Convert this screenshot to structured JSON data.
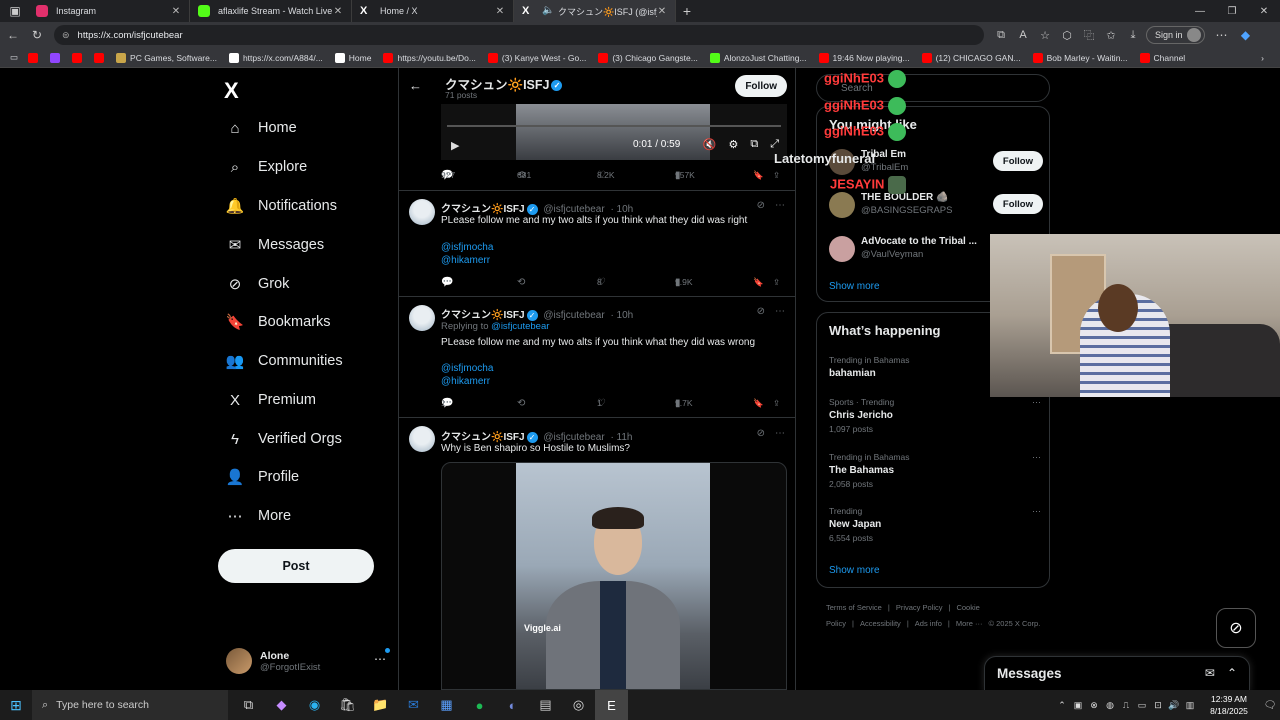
{
  "browser": {
    "tabs": [
      {
        "title": "Instagram",
        "color": "#e1306c"
      },
      {
        "title": "aflaxlife Stream - Watch Live on K",
        "color": "#53fc18"
      },
      {
        "title": "Home / X",
        "color": "#ffffff"
      },
      {
        "title": "クマシュン🔆ISFJ (@isfjcutebe",
        "color": "#ffffff"
      }
    ],
    "new_tab": "+",
    "url": "https://x.com/isfjcutebear",
    "sign_in": "Sign in",
    "bookmarks": [
      {
        "label": "",
        "color": "#ff0000"
      },
      {
        "label": "",
        "color": "#9146ff"
      },
      {
        "label": "",
        "color": "#ff0000"
      },
      {
        "label": "",
        "color": "#ff0000"
      },
      {
        "label": "PC Games, Software...",
        "color": "#c9a64a"
      },
      {
        "label": "https://x.com/A884/...",
        "color": "#ffffff"
      },
      {
        "label": "Home",
        "color": "#ffffff"
      },
      {
        "label": "https://youtu.be/Do...",
        "color": "#ff0000"
      },
      {
        "label": "(3) Kanye West - Go...",
        "color": "#ff0000"
      },
      {
        "label": "(3) Chicago Gangste...",
        "color": "#ff0000"
      },
      {
        "label": "AlonzoJust Chatting...",
        "color": "#53fc18"
      },
      {
        "label": "19:46 Now playing...",
        "color": "#ff0000"
      },
      {
        "label": "(12) CHICAGO GAN...",
        "color": "#ff0000"
      },
      {
        "label": "Bob Marley - Waitin...",
        "color": "#ff0000"
      },
      {
        "label": "Channel",
        "color": "#ff0000"
      }
    ]
  },
  "nav": {
    "logo": "X",
    "items": [
      {
        "label": "Home",
        "icon": "⌂"
      },
      {
        "label": "Explore",
        "icon": "⌕"
      },
      {
        "label": "Notifications",
        "icon": "🔔"
      },
      {
        "label": "Messages",
        "icon": "✉"
      },
      {
        "label": "Grok",
        "icon": "⊘"
      },
      {
        "label": "Bookmarks",
        "icon": "🔖"
      },
      {
        "label": "Communities",
        "icon": "👥"
      },
      {
        "label": "Premium",
        "icon": "X"
      },
      {
        "label": "Verified Orgs",
        "icon": "ϟ"
      },
      {
        "label": "Profile",
        "icon": "👤"
      },
      {
        "label": "More",
        "icon": "⋯"
      }
    ],
    "post": "Post",
    "user": {
      "name": "Alone",
      "handle": "@ForgotIExist"
    }
  },
  "profile": {
    "name": "クマシュン🔆ISFJ",
    "posts": "71 posts",
    "follow": "Follow"
  },
  "video1": {
    "time": "0:01 / 0:59"
  },
  "tweets": [
    {
      "stats": {
        "replies": "927",
        "reposts": "681",
        "likes": "8.2K",
        "views": "957K"
      }
    },
    {
      "name": "クマシュン🔆ISFJ",
      "handle": "@isfjcutebear",
      "time": "· 10h",
      "text": "PLease follow me and my two alts if you think what they did was right",
      "links": [
        "@isfjmocha",
        "@hikamerr"
      ],
      "stats": {
        "replies": "",
        "reposts": "",
        "likes": "8",
        "views": "9.9K"
      }
    },
    {
      "name": "クマシュン🔆ISFJ",
      "handle": "@isfjcutebear",
      "time": "· 10h",
      "reply_prefix": "Replying to",
      "reply_to": "@isfjcutebear",
      "text": "PLease follow me and my two alts if you think what they did was wrong",
      "links": [
        "@isfjmocha",
        "@hikamerr"
      ],
      "stats": {
        "replies": "1",
        "reposts": "",
        "likes": "1",
        "views": "9.7K"
      }
    },
    {
      "name": "クマシュン🔆ISFJ",
      "handle": "@isfjcutebear",
      "time": "· 11h",
      "text": "Why is Ben shapiro so Hostile to Muslims?",
      "watermark": "Viggle.ai"
    }
  ],
  "sidebar": {
    "search": "Search",
    "who_to_follow": "You might like",
    "suggestions": [
      {
        "name": "Tribal Em",
        "handle": "@TribalEm",
        "follow": "Follow"
      },
      {
        "name": "THE BOULDER 🪨",
        "handle": "@BASINGSEGRAPS",
        "follow": "Follow"
      },
      {
        "name": "AdVocate to the Tribal ...",
        "handle": "@VaulVeyman",
        "follow": ""
      }
    ],
    "show_more": "Show more",
    "happening_title": "What’s happening",
    "trends": [
      {
        "context": "Trending in Bahamas",
        "topic": "bahamian",
        "posts": ""
      },
      {
        "context": "Sports · Trending",
        "topic": "Chris Jericho",
        "posts": "1,097 posts"
      },
      {
        "context": "Trending in Bahamas",
        "topic": "The Bahamas",
        "posts": "2,058 posts"
      },
      {
        "context": "Trending",
        "topic": "New Japan",
        "posts": "6,554 posts"
      }
    ],
    "show_more_2": "Show more",
    "footer": [
      "Terms of Service",
      "|",
      "Privacy Policy",
      "|",
      "Cookie Policy",
      "|",
      "Accessibility",
      "|",
      "Ads info",
      "|",
      "More ···",
      "© 2025 X Corp."
    ],
    "messages": "Messages"
  },
  "overlay": {
    "chat": [
      {
        "text": "ggiNhE03",
        "color": "#ff3b3b"
      },
      {
        "text": "ggiNhE03",
        "color": "#ff3b3b"
      },
      {
        "text": "ggiNhE03",
        "color": "#ff3b3b"
      },
      {
        "text": "Latetomyfuneral",
        "color": "#d0d0d0"
      },
      {
        "text": "JESAYIN",
        "color": "#ff3b3b"
      }
    ]
  },
  "taskbar": {
    "search": "Type here to search",
    "time": "12:39 AM",
    "date": "8/18/2025"
  }
}
